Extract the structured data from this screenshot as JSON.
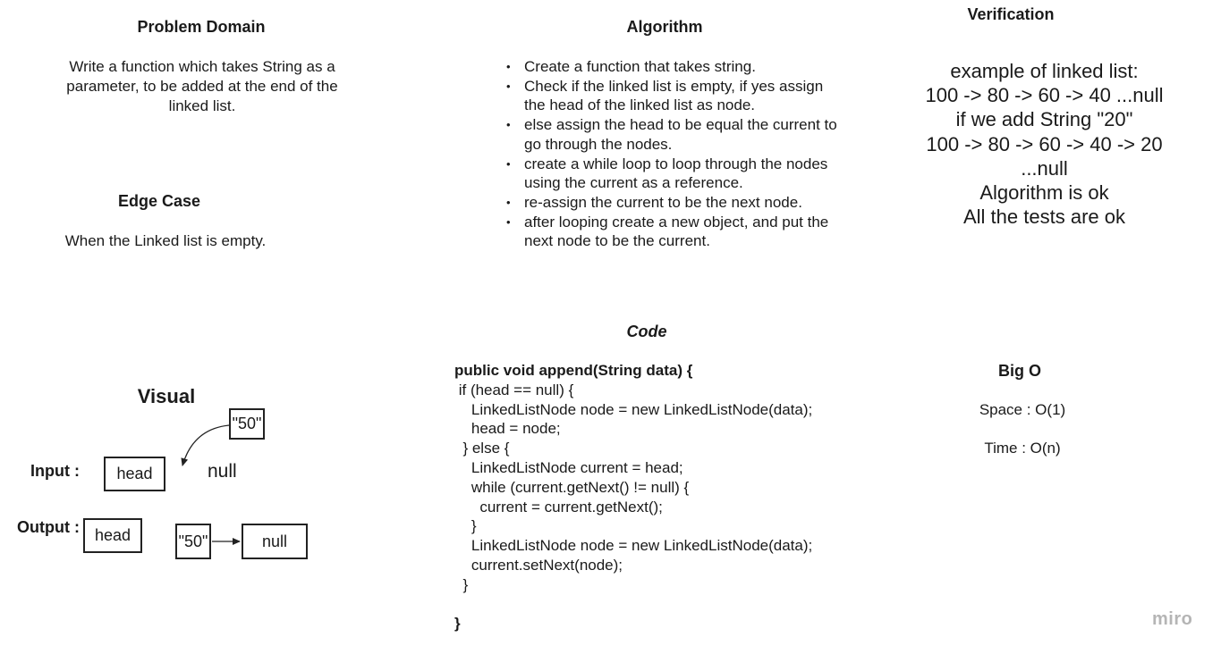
{
  "problem_domain": {
    "title": "Problem Domain",
    "text": "Write a function which takes String as a parameter, to be added at the end of the linked list."
  },
  "edge_case": {
    "title": "Edge Case",
    "text": "When the Linked list is empty."
  },
  "algorithm": {
    "title": "Algorithm",
    "steps": [
      "Create a function that takes string.",
      "Check if the linked list is empty, if yes assign the head of the linked list as node.",
      "else assign the head to be equal the current to go through the nodes.",
      "create a while loop to loop through the nodes using the current as a reference.",
      "re-assign the current to be the next node.",
      "after looping create a  new object, and put the next node to be the current."
    ]
  },
  "verification": {
    "title": "Verification",
    "lines": [
      "example of linked list:",
      "100 -> 80 -> 60 -> 40 ...null",
      "if we add String \"20\"",
      "100 -> 80 -> 60 -> 40 -> 20",
      "...null",
      "Algorithm is ok",
      "All the tests are ok"
    ]
  },
  "code": {
    "title": "Code",
    "lines": [
      "public void append(String data) {",
      " if (head == null) {",
      "    LinkedListNode node = new LinkedListNode(data);",
      "    head = node;",
      "  } else {",
      "    LinkedListNode current = head;",
      "    while (current.getNext() != null) {",
      "      current = current.getNext();",
      "    }",
      "    LinkedListNode node = new LinkedListNode(data);",
      "    current.setNext(node);",
      "  }",
      "",
      "}"
    ]
  },
  "big_o": {
    "title": "Big O",
    "space": "Space : O(1)",
    "time": "Time : O(n)"
  },
  "visual": {
    "title": "Visual",
    "input_label": "Input :",
    "output_label": "Output :",
    "input_head": "head",
    "input_value": "\"50\"",
    "input_null": "null",
    "output_head": "head",
    "output_value": "\"50\"",
    "output_null": "null"
  },
  "watermark": "miro",
  "colors": {
    "text": "#1a1a1a",
    "box_border": "#222222",
    "watermark": "#b5b5b5"
  }
}
